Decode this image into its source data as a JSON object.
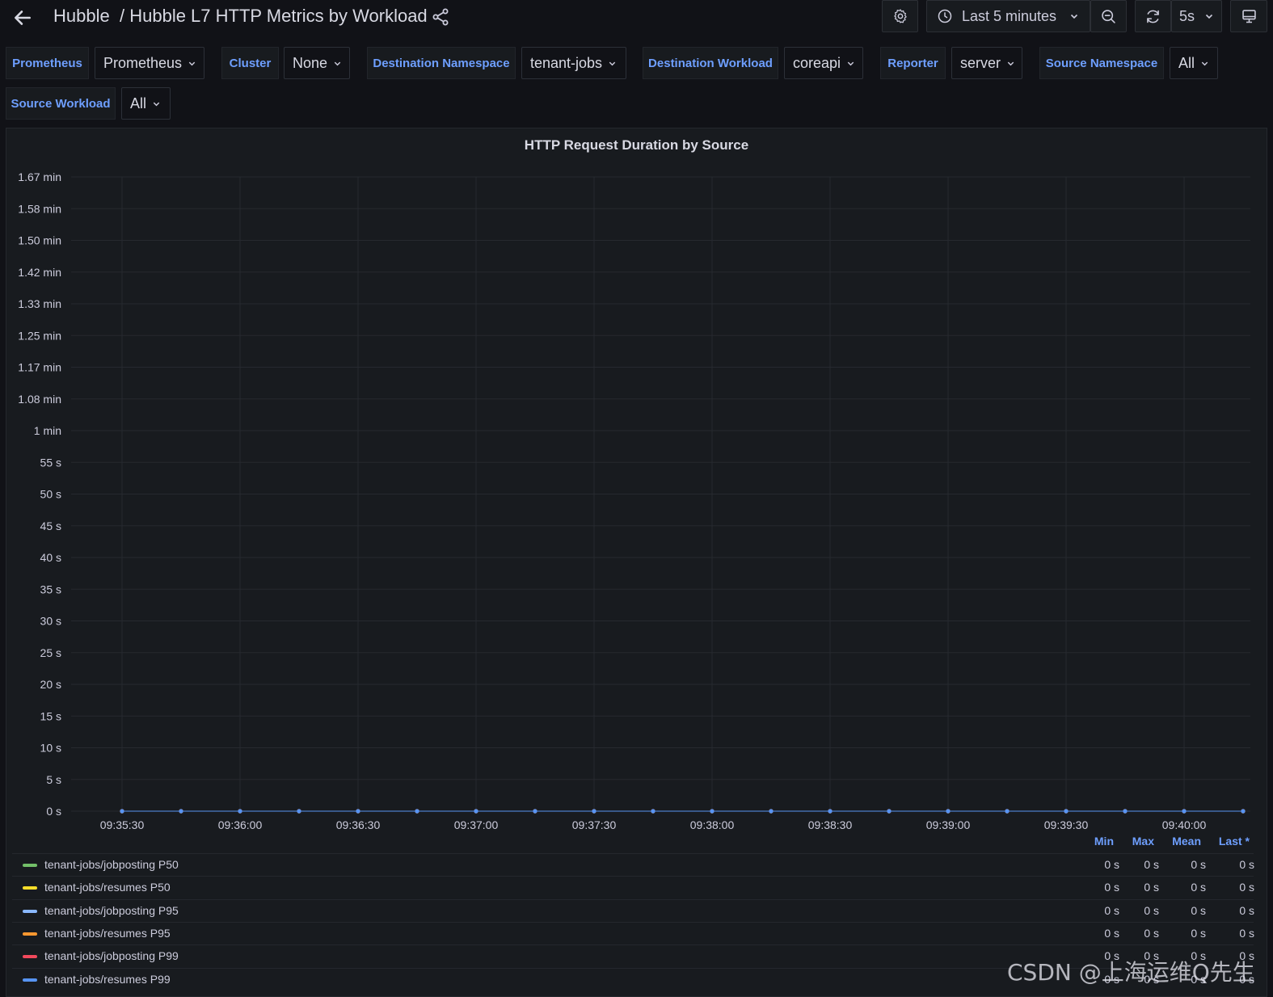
{
  "header": {
    "breadcrumb_root": "Hubble",
    "title": "/ Hubble L7 HTTP Metrics by Workload",
    "time_range": "Last 5 minutes",
    "refresh_interval": "5s"
  },
  "variables": [
    {
      "label": "Prometheus",
      "value": "Prometheus"
    },
    {
      "label": "Cluster",
      "value": "None"
    },
    {
      "label": "Destination Namespace",
      "value": "tenant-jobs"
    },
    {
      "label": "Destination Workload",
      "value": "coreapi"
    },
    {
      "label": "Reporter",
      "value": "server"
    },
    {
      "label": "Source Namespace",
      "value": "All"
    },
    {
      "label": "Source Workload",
      "value": "All"
    }
  ],
  "panel": {
    "title": "HTTP Request Duration by Source"
  },
  "chart_data": {
    "type": "line",
    "title": "HTTP Request Duration by Source",
    "y_ticks": [
      "0 s",
      "5 s",
      "10 s",
      "15 s",
      "20 s",
      "25 s",
      "30 s",
      "35 s",
      "40 s",
      "45 s",
      "50 s",
      "55 s",
      "1 min",
      "1.08 min",
      "1.17 min",
      "1.25 min",
      "1.33 min",
      "1.42 min",
      "1.50 min",
      "1.58 min",
      "1.67 min"
    ],
    "ylim_seconds": [
      0,
      100
    ],
    "x_ticks": [
      "09:35:30",
      "09:36:00",
      "09:36:30",
      "09:37:00",
      "09:37:30",
      "09:38:00",
      "09:38:30",
      "09:39:00",
      "09:39:30",
      "09:40:00"
    ],
    "x": [
      "09:35:30",
      "09:35:45",
      "09:36:00",
      "09:36:15",
      "09:36:30",
      "09:36:45",
      "09:37:00",
      "09:37:15",
      "09:37:30",
      "09:37:45",
      "09:38:00",
      "09:38:15",
      "09:38:30",
      "09:38:45",
      "09:39:00",
      "09:39:15",
      "09:39:30",
      "09:39:45",
      "09:40:00",
      "09:40:15"
    ],
    "grid": true,
    "series": [
      {
        "name": "tenant-jobs/jobposting P50",
        "color": "#73bf69",
        "values": [
          0,
          0,
          0,
          0,
          0,
          0,
          0,
          0,
          0,
          0,
          0,
          0,
          0,
          0,
          0,
          0,
          0,
          0,
          0,
          0
        ]
      },
      {
        "name": "tenant-jobs/resumes P50",
        "color": "#fade2a",
        "values": [
          0,
          0,
          0,
          0,
          0,
          0,
          0,
          0,
          0,
          0,
          0,
          0,
          0,
          0,
          0,
          0,
          0,
          0,
          0,
          0
        ]
      },
      {
        "name": "tenant-jobs/jobposting P95",
        "color": "#8ab8ff",
        "values": [
          0,
          0,
          0,
          0,
          0,
          0,
          0,
          0,
          0,
          0,
          0,
          0,
          0,
          0,
          0,
          0,
          0,
          0,
          0,
          0
        ]
      },
      {
        "name": "tenant-jobs/resumes P95",
        "color": "#ff9830",
        "values": [
          0,
          0,
          0,
          0,
          0,
          0,
          0,
          0,
          0,
          0,
          0,
          0,
          0,
          0,
          0,
          0,
          0,
          0,
          0,
          0
        ]
      },
      {
        "name": "tenant-jobs/jobposting P99",
        "color": "#f2495c",
        "values": [
          0,
          0,
          0,
          0,
          0,
          0,
          0,
          0,
          0,
          0,
          0,
          0,
          0,
          0,
          0,
          0,
          0,
          0,
          0,
          0
        ]
      },
      {
        "name": "tenant-jobs/resumes P99",
        "color": "#5794f2",
        "values": [
          0,
          0,
          0,
          0,
          0,
          0,
          0,
          0,
          0,
          0,
          0,
          0,
          0,
          0,
          0,
          0,
          0,
          0,
          0,
          0
        ]
      }
    ]
  },
  "legend": {
    "columns": [
      "Min",
      "Max",
      "Mean",
      "Last *"
    ],
    "rows": [
      {
        "name": "tenant-jobs/jobposting P50",
        "color": "#73bf69",
        "min": "0 s",
        "max": "0 s",
        "mean": "0 s",
        "last": "0 s"
      },
      {
        "name": "tenant-jobs/resumes P50",
        "color": "#fade2a",
        "min": "0 s",
        "max": "0 s",
        "mean": "0 s",
        "last": "0 s"
      },
      {
        "name": "tenant-jobs/jobposting P95",
        "color": "#8ab8ff",
        "min": "0 s",
        "max": "0 s",
        "mean": "0 s",
        "last": "0 s"
      },
      {
        "name": "tenant-jobs/resumes P95",
        "color": "#ff9830",
        "min": "0 s",
        "max": "0 s",
        "mean": "0 s",
        "last": "0 s"
      },
      {
        "name": "tenant-jobs/jobposting P99",
        "color": "#f2495c",
        "min": "0 s",
        "max": "0 s",
        "mean": "0 s",
        "last": "0 s"
      },
      {
        "name": "tenant-jobs/resumes P99",
        "color": "#5794f2",
        "min": "0 s",
        "max": "0 s",
        "mean": "0 s",
        "last": "0 s"
      }
    ]
  },
  "watermark": "CSDN @上海运维Q先生"
}
